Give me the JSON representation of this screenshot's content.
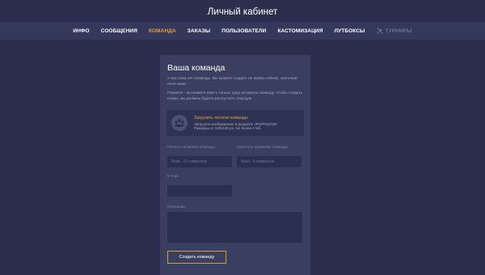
{
  "header": {
    "title": "Личный кабинет"
  },
  "nav": {
    "items": [
      {
        "label": "ИНФО"
      },
      {
        "label": "СООБЩЕНИЯ"
      },
      {
        "label": "КОМАНДА"
      },
      {
        "label": "ЗАКАЗЫ"
      },
      {
        "label": "ПОЛЬЗОВАТЕЛИ"
      },
      {
        "label": "КАСТОМИЗАЦИЯ"
      },
      {
        "label": "ЛУТБОКСЫ"
      },
      {
        "label": "ТУРНИРЫ",
        "icon": "tools-icon"
      }
    ],
    "active_index": 2,
    "colors": {
      "active": "#e8a13a",
      "disabled": "#6d7290"
    }
  },
  "team": {
    "title": "Ваша команда",
    "note1": "У вас пока нет команды. Вы можете создать ее прямо сейчас, заполнив поля ниже.",
    "note2": "Помните - вы можете иметь только одну активную команду. Чтобы создать новую, вы должны будете распустить текущую.",
    "upload": {
      "icon": "team-avatar-icon",
      "title": "Загрузить логотип команды",
      "line1": "Загрузите изображение в формате JPG/PNG/GIF.",
      "line2": "Размеры от 100х100 px. Не более 2 Мб."
    },
    "full_name": {
      "label": "Полное название команды",
      "placeholder": "Макс. 15 символов",
      "value": ""
    },
    "short_name": {
      "label": "Короткое название команды",
      "placeholder": "Макс. 6 символов",
      "value": ""
    },
    "email": {
      "label": "E-mail",
      "value": ""
    },
    "description": {
      "label": "Описание",
      "value": ""
    },
    "submit_label": "Создать команду"
  }
}
